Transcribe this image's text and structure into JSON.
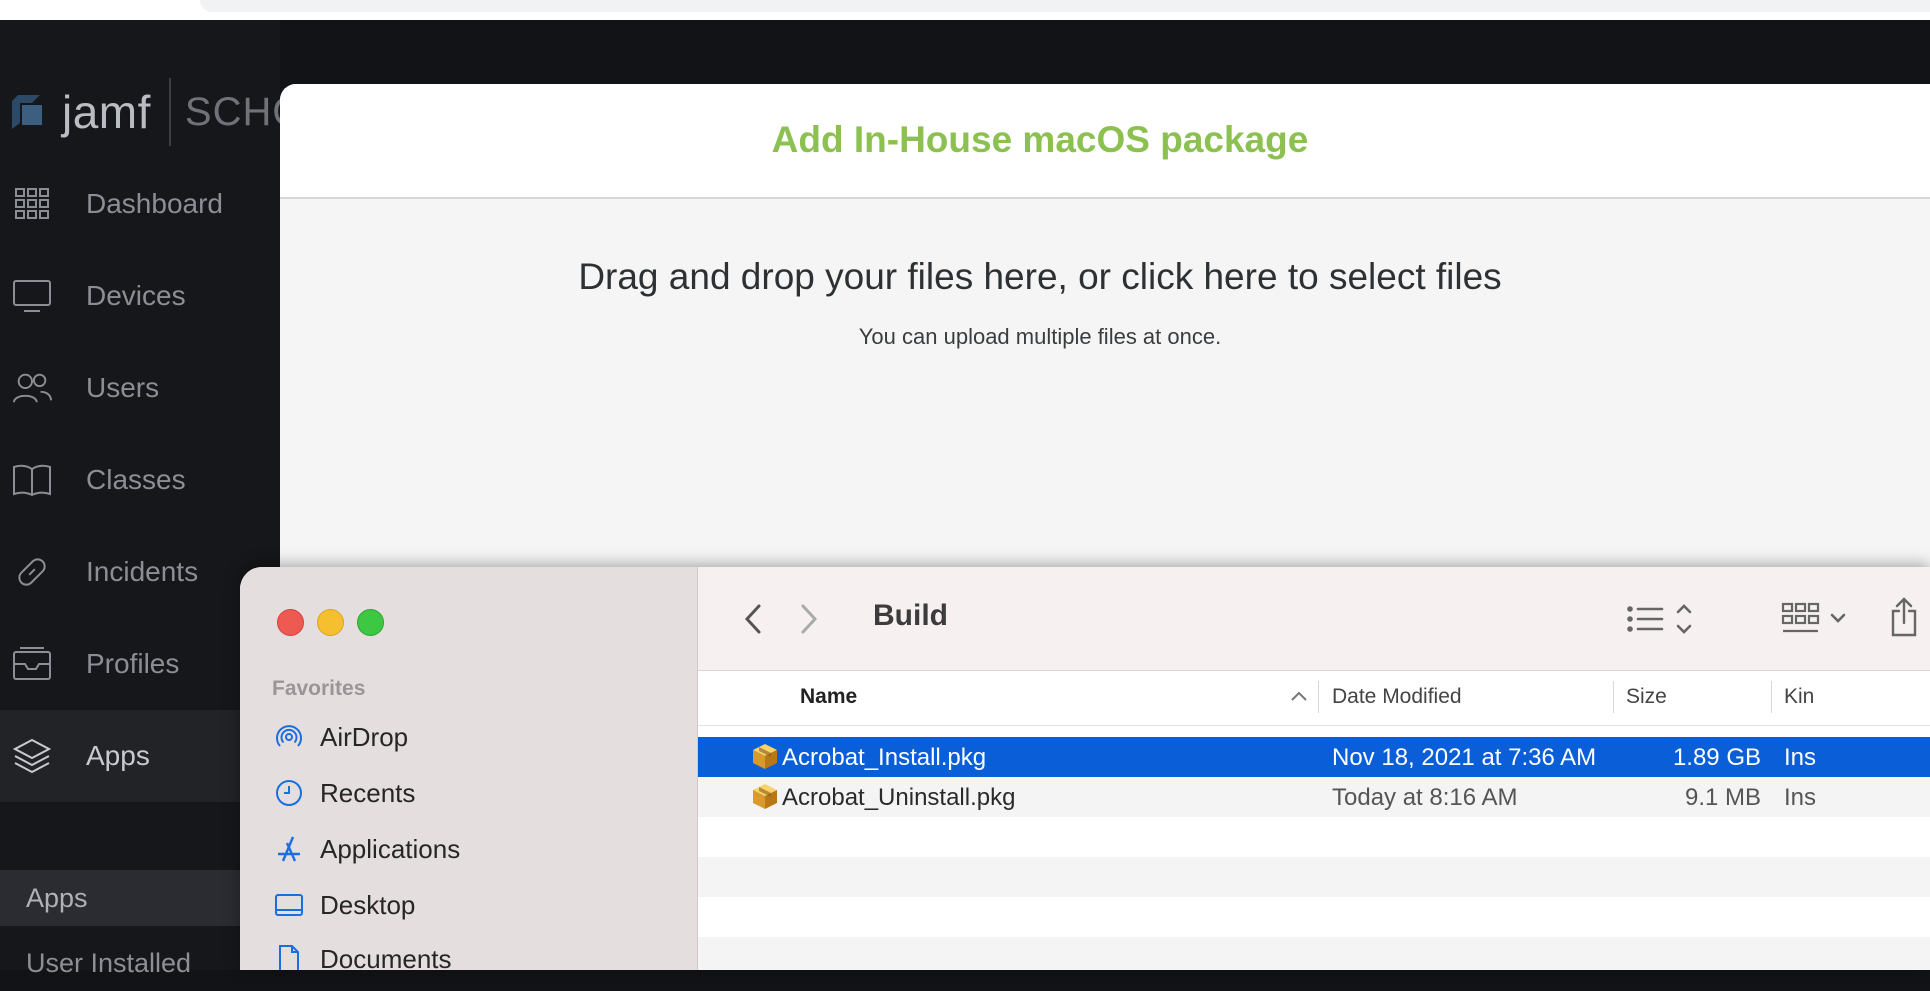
{
  "app": {
    "logo_text": "jamf",
    "logo_sub": "SCHO",
    "nav": [
      {
        "label": "Dashboard",
        "icon": "grid-icon"
      },
      {
        "label": "Devices",
        "icon": "monitor-icon"
      },
      {
        "label": "Users",
        "icon": "users-icon"
      },
      {
        "label": "Classes",
        "icon": "book-icon"
      },
      {
        "label": "Incidents",
        "icon": "bandage-icon"
      },
      {
        "label": "Profiles",
        "icon": "inbox-icon"
      },
      {
        "label": "Apps",
        "icon": "layers-icon"
      }
    ],
    "subnav": [
      {
        "label": "Apps"
      },
      {
        "label": "User Installed"
      }
    ]
  },
  "modal": {
    "title": "Add In-House macOS package",
    "drop_title": "Drag and drop your files here, or click here to select files",
    "drop_sub": "You can upload multiple files at once."
  },
  "finder": {
    "folder": "Build",
    "favorites_label": "Favorites",
    "sidebar": [
      {
        "label": "AirDrop",
        "icon": "airdrop-icon"
      },
      {
        "label": "Recents",
        "icon": "clock-icon"
      },
      {
        "label": "Applications",
        "icon": "applications-icon"
      },
      {
        "label": "Desktop",
        "icon": "desktop-icon"
      },
      {
        "label": "Documents",
        "icon": "document-icon"
      }
    ],
    "columns": {
      "name": "Name",
      "date": "Date Modified",
      "size": "Size",
      "kind": "Kin"
    },
    "files": [
      {
        "name": "Acrobat_Install.pkg",
        "date": "Nov 18, 2021 at 7:36 AM",
        "size": "1.89 GB",
        "kind": "Ins",
        "selected": true
      },
      {
        "name": "Acrobat_Uninstall.pkg",
        "date": "Today at 8:16 AM",
        "size": "9.1 MB",
        "kind": "Ins",
        "selected": false
      }
    ]
  },
  "colors": {
    "accent_green": "#8cc152",
    "selection_blue": "#0a5fd8",
    "mac_blue": "#1a6fe0"
  }
}
